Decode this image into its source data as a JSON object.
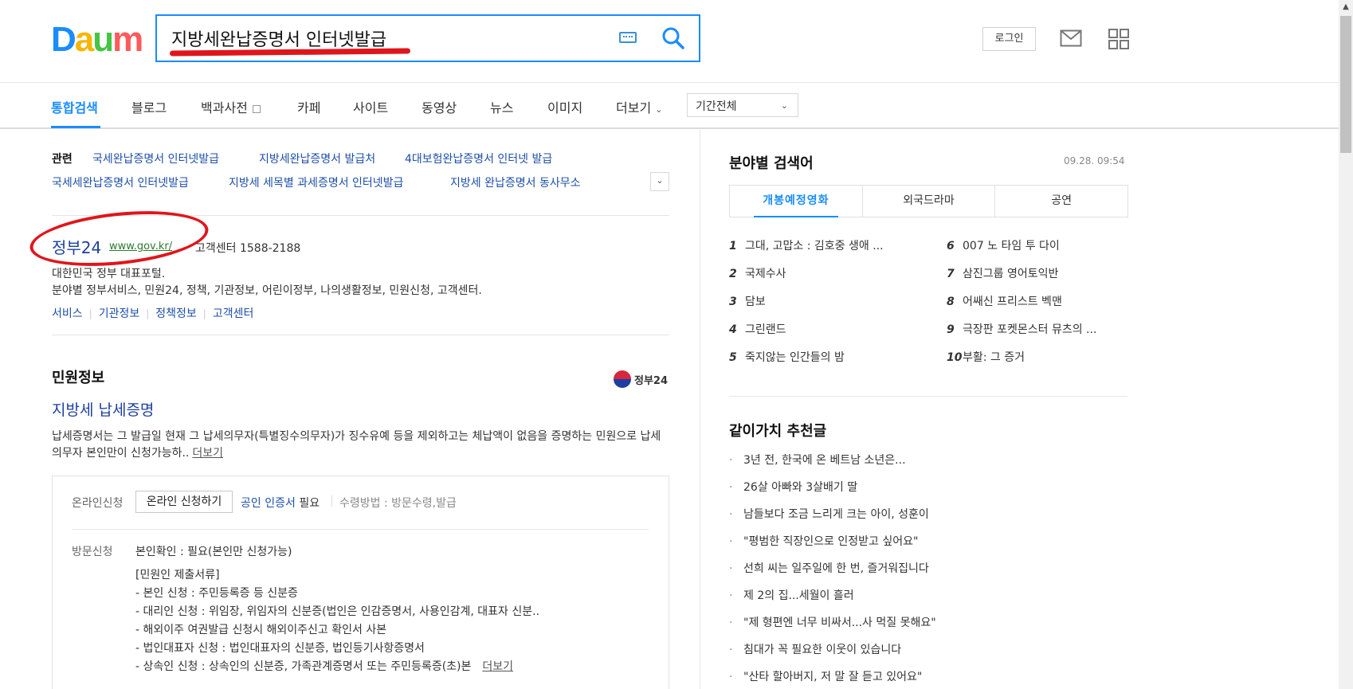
{
  "header": {
    "logo": {
      "letters": [
        "D",
        "a",
        "u",
        "m"
      ],
      "colors": [
        "#1a8cff",
        "#f7b500",
        "#45c445",
        "#ff5a5a"
      ]
    },
    "search": {
      "value": "지방세완납증명서 인터넷발급",
      "keyboard_icon": "keyboard-icon",
      "search_icon": "search-icon"
    },
    "login_label": "로그인",
    "mail_icon": "mail-icon",
    "apps_icon": "apps-grid-icon"
  },
  "tabs": {
    "items": [
      "통합검색",
      "블로그",
      "백과사전",
      "카페",
      "사이트",
      "동영상",
      "뉴스",
      "이미지",
      "더보기"
    ],
    "active": "통합검색",
    "period": "기간전체"
  },
  "related": {
    "label": "관련",
    "links": [
      "국세완납증명서 인터넷발급",
      "지방세완납증명서 발급처",
      "4대보험완납증명서 인터넷 발급",
      "국세세완납증명서 인터넷발급",
      "지방세 세목별 과세증명서 인터넷발급",
      "지방세 완납증명서 동사무소"
    ]
  },
  "site": {
    "title": "정부24",
    "url": "www.gov.kr/",
    "tel": "고객센터 1588-2188",
    "desc1": "대한민국 정부 대표포털.",
    "desc2": "분야별 정부서비스, 민원24, 정책, 기관정보, 어린이정부, 나의생활정보, 민원신청, 고객센터.",
    "links": [
      "서비스",
      "기관정보",
      "정책정보",
      "고객센터"
    ]
  },
  "civil": {
    "section_title": "민원정보",
    "provider": "정부24",
    "doc_title": "지방세 납세증명",
    "doc_desc": "납세증명서는 그 발급일 현재 그 납세의무자(특별징수의무자)가 징수유예 등을 제외하고는 체납액이 없음을 증명하는 민원으로 납세의무자 본인만이 신청가능하..",
    "more": "더보기",
    "online_label": "온라인신청",
    "online_button": "온라인 신청하기",
    "cert": "공인 인증서",
    "cert_need": "필요",
    "receive": "수령방법 : 방문수령,발급",
    "visit_label": "방문신청",
    "visit_lines": [
      "본인확인 : 필요(본인만 신청가능)",
      "[민원인 제출서류]",
      "- 본인 신청 : 주민등록증 등 신분증",
      "- 대리인 신청 : 위임장, 위임자의 신분증(법인은 인감증명서, 사용인감계, 대표자 신분..",
      "- 해외이주 여권발급 신청시 해외이주신고 확인서 사본",
      "- 법인대표자 신청 : 법인대표자의 신분증, 법인등기사항증명서",
      "- 상속인 신청 : 상속인의 신분증, 가족관계증명서 또는 주민등록증(초)본"
    ]
  },
  "right": {
    "title": "분야별 검색어",
    "time": "09.28. 09:54",
    "tabs": [
      "개봉예정영화",
      "외국드라마",
      "공연"
    ],
    "active_tab": "개봉예정영화",
    "ranks": [
      {
        "num": "1",
        "text": "그대, 고맙소 : 김호중 생애 ..."
      },
      {
        "num": "2",
        "text": "국제수사"
      },
      {
        "num": "3",
        "text": "담보"
      },
      {
        "num": "4",
        "text": "그린랜드"
      },
      {
        "num": "5",
        "text": "죽지않는 인간들의 밤"
      },
      {
        "num": "6",
        "text": "007 노 타임 투 다이"
      },
      {
        "num": "7",
        "text": "삼진그룹 영어토익반"
      },
      {
        "num": "8",
        "text": "어쌔신 프리스트 벡맨"
      },
      {
        "num": "9",
        "text": "극장판 포켓몬스터 뮤츠의 ..."
      },
      {
        "num": "10",
        "text": "부활: 그 증거"
      }
    ],
    "rec_title": "같이가치 추천글",
    "recs": [
      "3년 전, 한국에 온 베트남 소년은...",
      "26살 아빠와 3살배기 딸",
      "남들보다 조금 느리게 크는 아이, 성훈이",
      "\"평범한 직장인으로 인정받고 싶어요\"",
      "선희 씨는 일주일에 한 번, 즐거워집니다",
      "제 2의 집...세월이 흘러",
      "\"제 형편엔 너무 비싸서...사 먹질 못해요\"",
      "침대가 꼭 필요한 이웃이 있습니다",
      "\"산타 할아버지, 저 말 잘 듣고 있어요\""
    ]
  }
}
